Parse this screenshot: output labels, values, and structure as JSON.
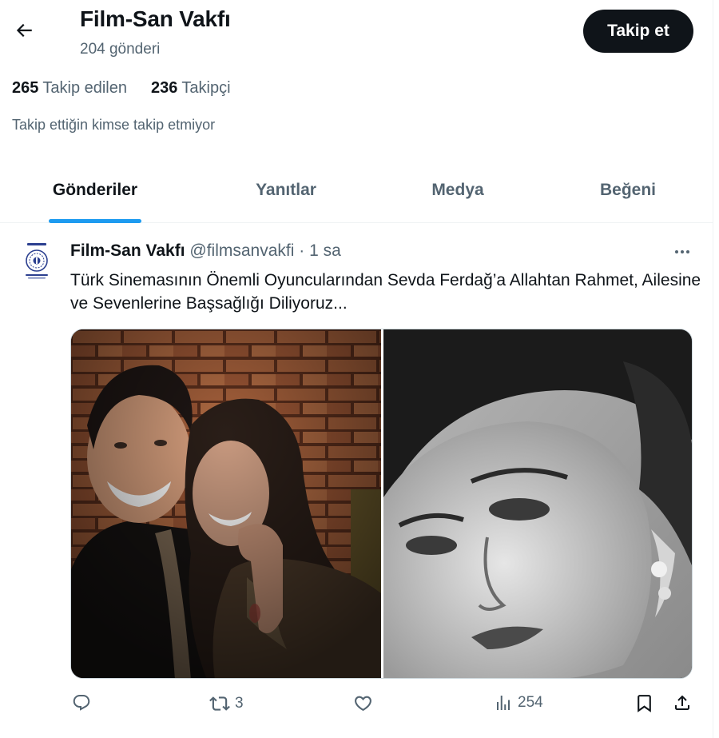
{
  "header": {
    "profile_name": "Film-San Vakfı",
    "post_count": "204 gönderi",
    "follow_label": "Takip et"
  },
  "stats": {
    "following_count": "265",
    "following_label": "Takip edilen",
    "followers_count": "236",
    "followers_label": "Takipçi"
  },
  "followed_note": "Takip ettiğin kimse takip etmiyor",
  "tabs": [
    {
      "label": "Gönderiler",
      "active": true
    },
    {
      "label": "Yanıtlar",
      "active": false
    },
    {
      "label": "Medya",
      "active": false
    },
    {
      "label": "Beğeni",
      "active": false
    }
  ],
  "tweet": {
    "author_name": "Film-San Vakfı",
    "author_handle": "@filmsanvakfi",
    "separator": "·",
    "time": "1 sa",
    "text": "Türk Sinemasının Önemli Oyuncularından Sevda Ferdağ’a Allahtan Rahmet, Ailesine ve Sevenlerine Başsağlığı Diliyoruz...",
    "avatar_logo_text": "FİLM - SAN VAKFI",
    "actions": {
      "reply_count": "",
      "retweet_count": "3",
      "like_count": "",
      "views_count": "254"
    }
  },
  "icons": {
    "back": "arrow-left-icon",
    "more": "more-horizontal-icon",
    "reply": "reply-icon",
    "retweet": "retweet-icon",
    "like": "heart-icon",
    "views": "views-icon",
    "bookmark": "bookmark-icon",
    "share": "share-icon"
  },
  "colors": {
    "accent": "#1d9bf0",
    "text_primary": "#0f1419",
    "text_secondary": "#536471",
    "follow_button_bg": "#0f1419"
  }
}
